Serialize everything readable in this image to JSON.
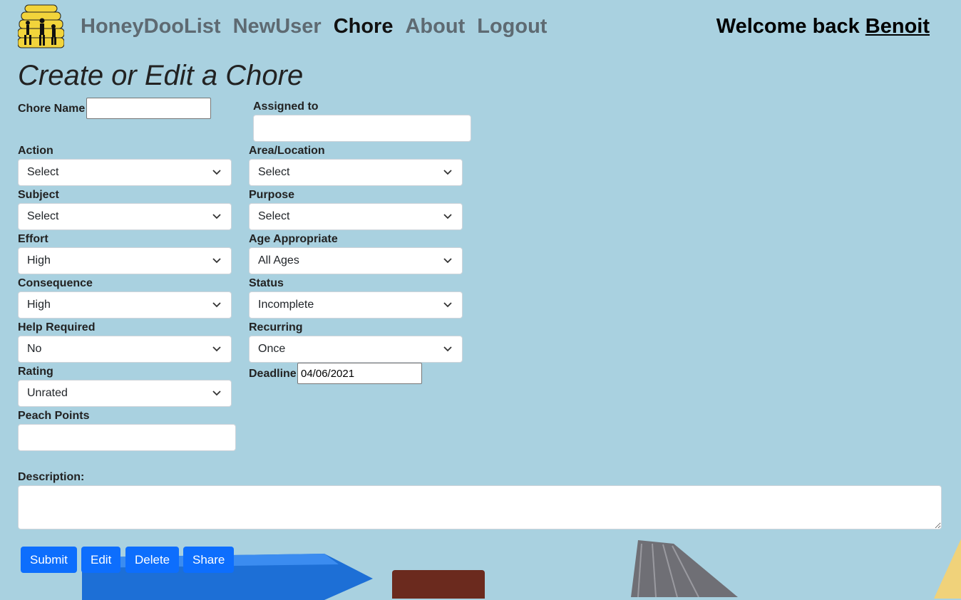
{
  "nav": {
    "items": [
      {
        "label": "HoneyDooList",
        "active": false
      },
      {
        "label": "NewUser",
        "active": false
      },
      {
        "label": "Chore",
        "active": true
      },
      {
        "label": "About",
        "active": false
      },
      {
        "label": "Logout",
        "active": false
      }
    ],
    "welcome_prefix": "Welcome back",
    "username": "Benoit"
  },
  "page": {
    "title": "Create or Edit a Chore"
  },
  "form": {
    "chore_name": {
      "label": "Chore Name",
      "value": ""
    },
    "assigned_to": {
      "label": "Assigned to",
      "value": ""
    },
    "action": {
      "label": "Action",
      "value": "Select"
    },
    "area": {
      "label": "Area/Location",
      "value": "Select"
    },
    "subject": {
      "label": "Subject",
      "value": "Select"
    },
    "purpose": {
      "label": "Purpose",
      "value": "Select"
    },
    "effort": {
      "label": "Effort",
      "value": "High"
    },
    "age": {
      "label": "Age Appropriate",
      "value": "All Ages"
    },
    "consequence": {
      "label": "Consequence",
      "value": "High"
    },
    "status": {
      "label": "Status",
      "value": "Incomplete"
    },
    "help": {
      "label": "Help Required",
      "value": "No"
    },
    "recurring": {
      "label": "Recurring",
      "value": "Once"
    },
    "rating": {
      "label": "Rating",
      "value": "Unrated"
    },
    "deadline": {
      "label": "Deadline",
      "value": "04/06/2021"
    },
    "peach_points": {
      "label": "Peach Points",
      "value": ""
    },
    "description": {
      "label": "Description:",
      "value": ""
    }
  },
  "buttons": {
    "submit": "Submit",
    "edit": "Edit",
    "delete": "Delete",
    "share": "Share"
  },
  "colors": {
    "background": "#a9d1e0",
    "primary_button": "#0d6efd",
    "nav_inactive": "#5e6a72",
    "nav_active": "#111111"
  }
}
